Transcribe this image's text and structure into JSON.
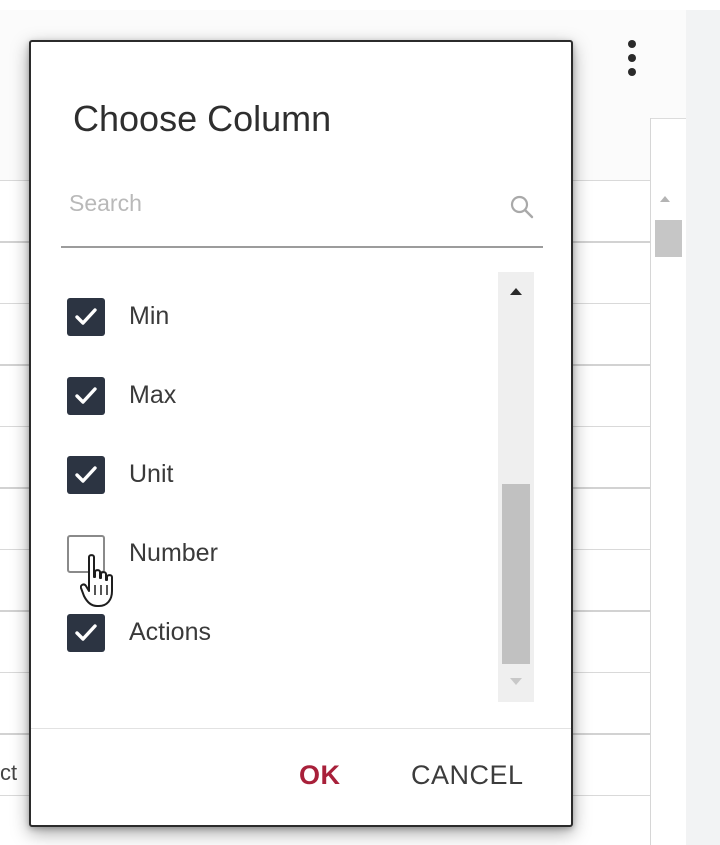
{
  "dialog": {
    "title": "Choose Column",
    "search": {
      "placeholder": "Search",
      "value": ""
    },
    "columns": [
      {
        "label": "Min",
        "checked": true
      },
      {
        "label": "Max",
        "checked": true
      },
      {
        "label": "Unit",
        "checked": true
      },
      {
        "label": "Number",
        "checked": false
      },
      {
        "label": "Actions",
        "checked": true
      }
    ],
    "buttons": {
      "ok": "OK",
      "cancel": "CANCEL"
    }
  },
  "background": {
    "partial_cell_text": "ct"
  },
  "colors": {
    "accent_ok": "#a8203a",
    "checkbox_checked": "#2c3442",
    "checkbox_unchecked_border": "#8a8a8a"
  },
  "icons": {
    "search": "search-icon",
    "checkmark": "checkmark-icon",
    "more": "more-vertical-icon",
    "cursor": "hand-pointer-cursor"
  }
}
